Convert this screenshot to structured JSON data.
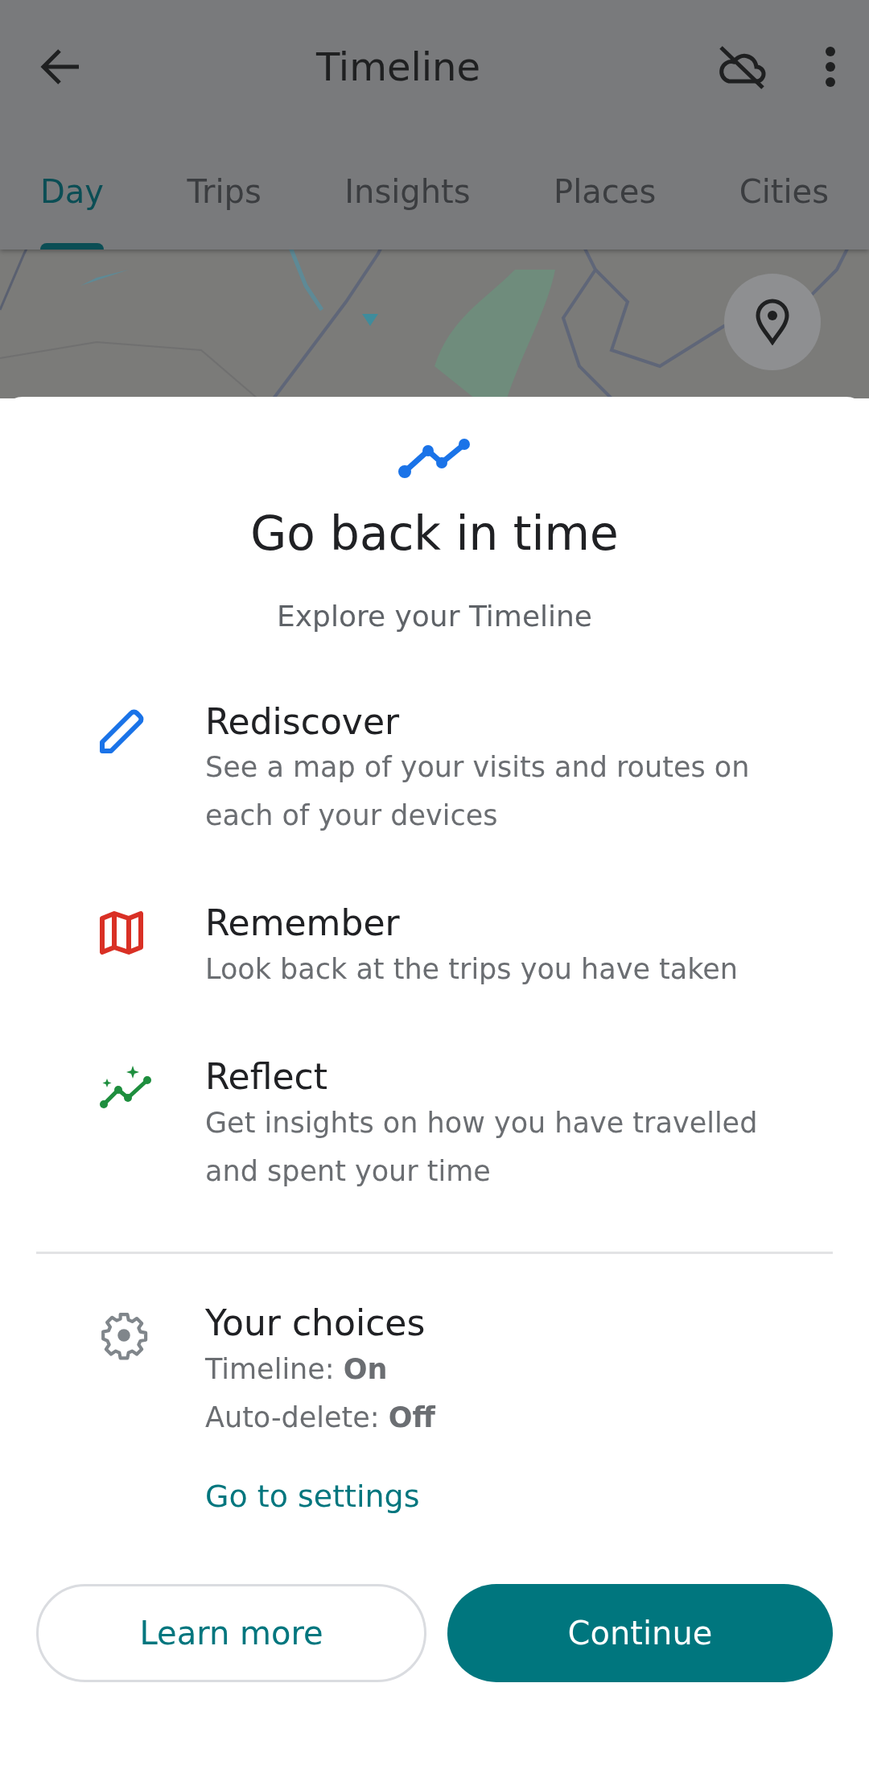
{
  "app_bar": {
    "title": "Timeline"
  },
  "tabs": [
    {
      "label": "Day",
      "selected": true
    },
    {
      "label": "Trips",
      "selected": false
    },
    {
      "label": "Insights",
      "selected": false
    },
    {
      "label": "Places",
      "selected": false
    },
    {
      "label": "Cities",
      "selected": false
    }
  ],
  "sheet": {
    "title": "Go back in time",
    "subtitle": "Explore your Timeline",
    "features": [
      {
        "kind": "pencil",
        "title": "Rediscover",
        "text": "See a map of your visits and routes on each of your devices"
      },
      {
        "kind": "map",
        "title": "Remember",
        "text": "Look back at the trips you have taken"
      },
      {
        "kind": "trend",
        "title": "Reflect",
        "text": "Get insights on how you have travelled and spent your time"
      }
    ],
    "choices": {
      "title": "Your choices",
      "lines": [
        "Timeline: **On**",
        "Auto-delete: **Off**"
      ],
      "link": "Go to settings"
    },
    "buttons": [
      {
        "kind": "outline",
        "label": "Learn more"
      },
      {
        "kind": "filled",
        "label": "Continue"
      }
    ]
  }
}
